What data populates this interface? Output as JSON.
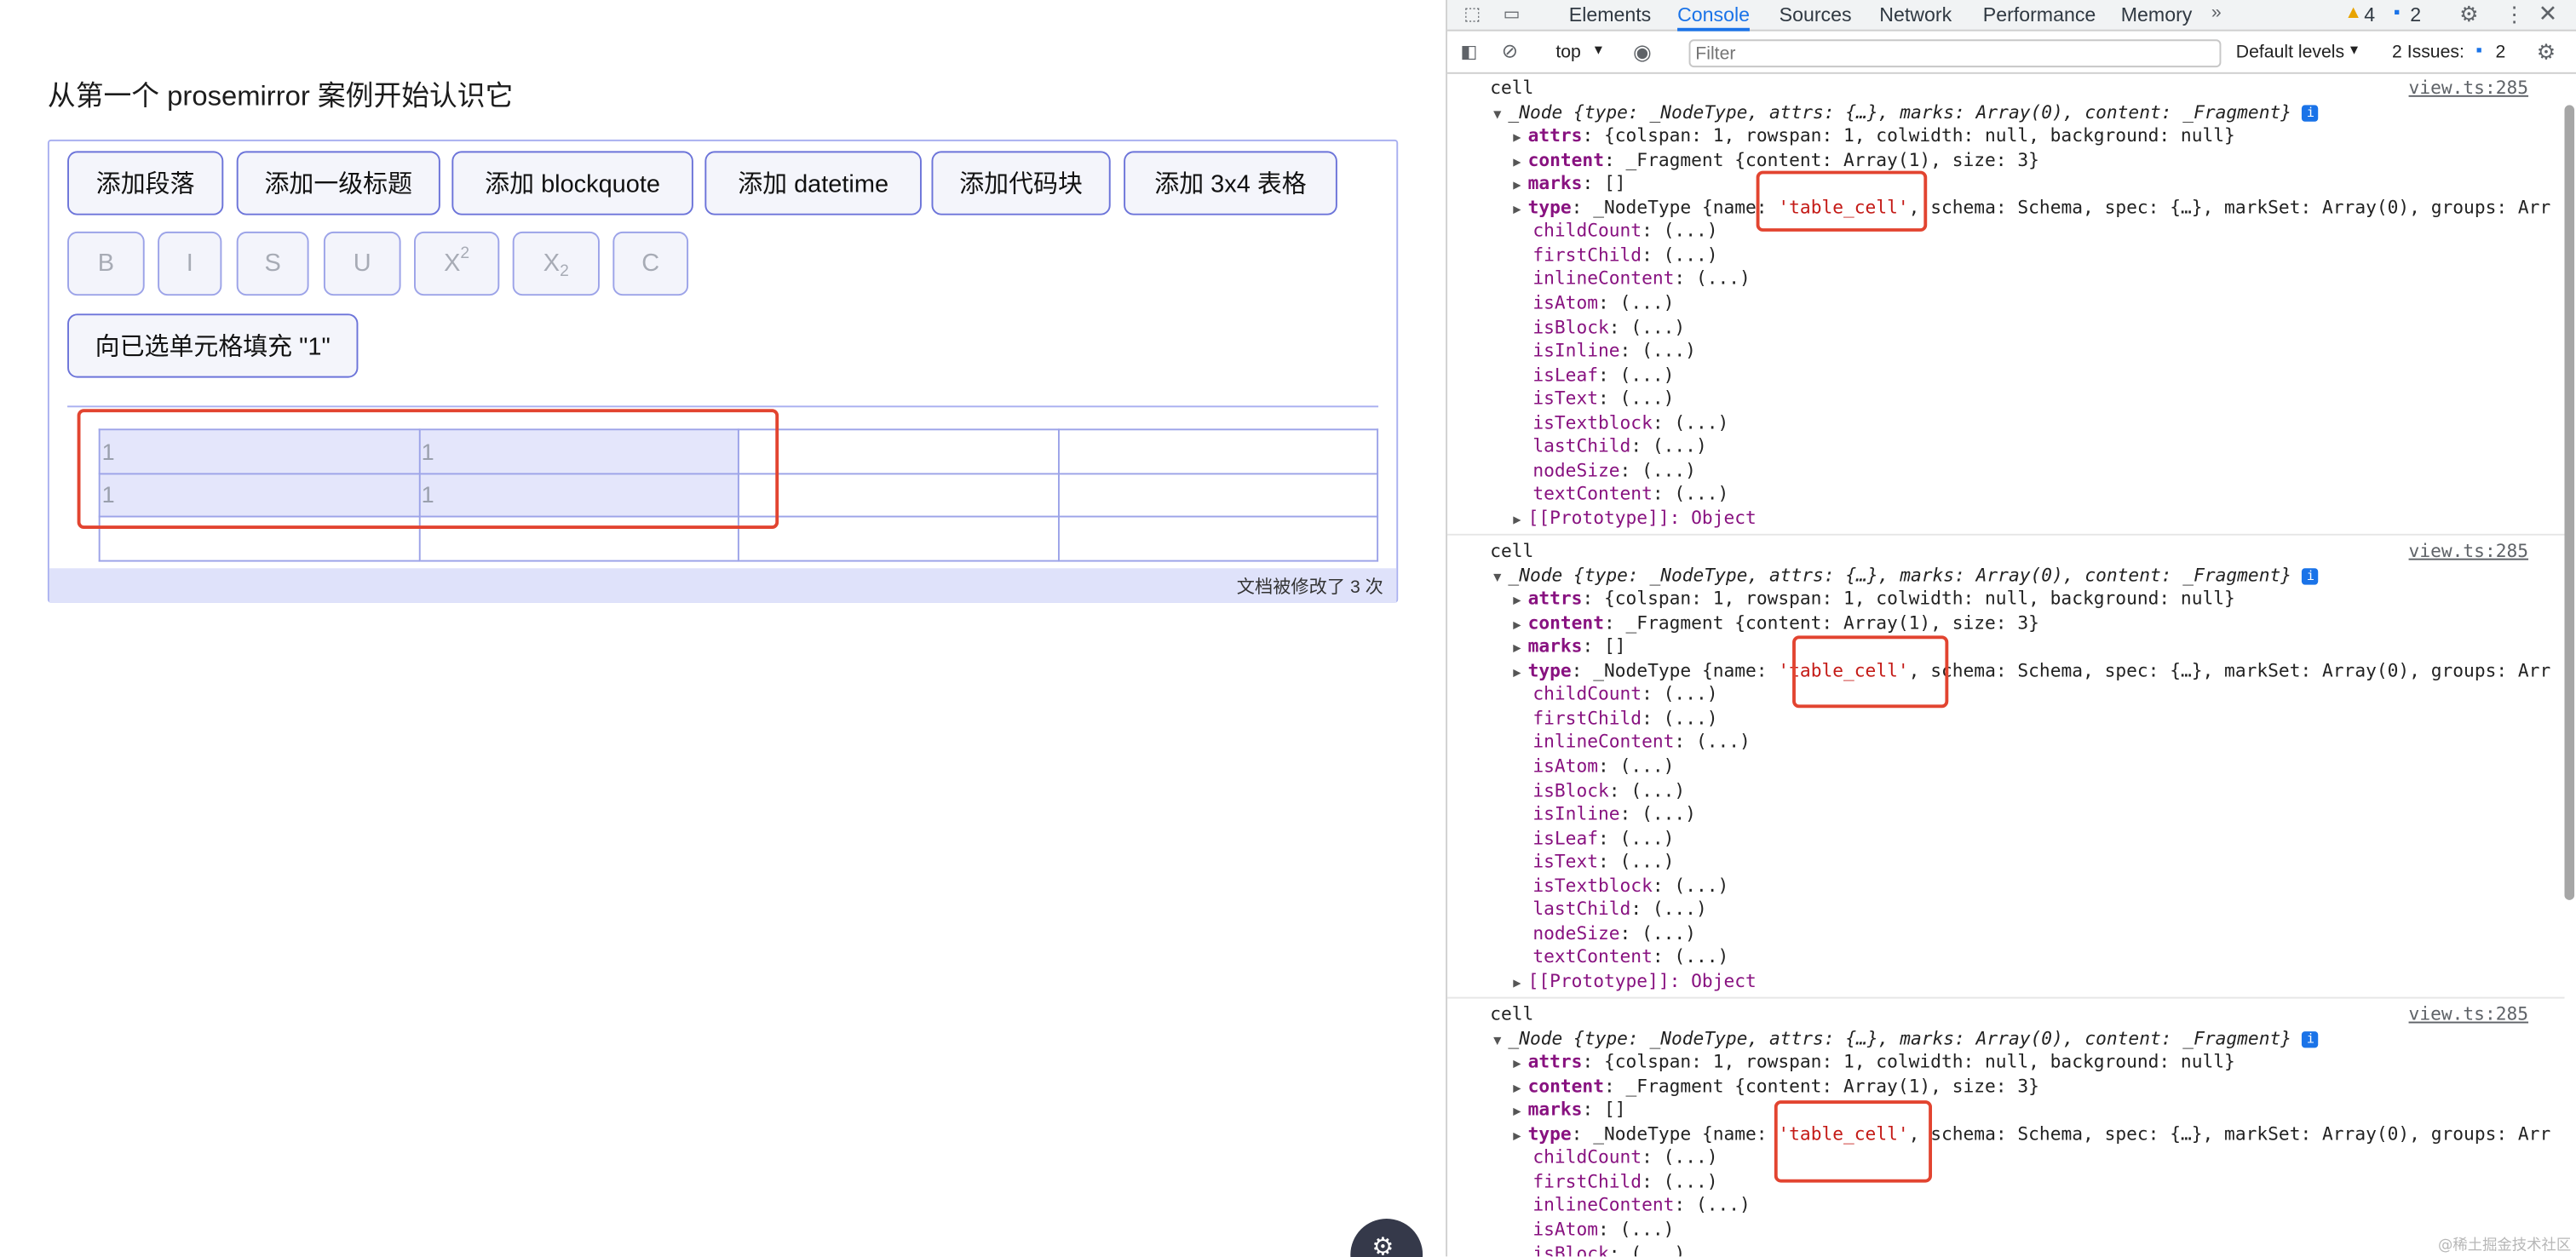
{
  "app": {
    "title": "从第一个 prosemirror 案例开始认识它"
  },
  "toolbar_buttons": [
    {
      "label": "添加段落"
    },
    {
      "label": "添加一级标题"
    },
    {
      "label": "添加 blockquote"
    },
    {
      "label": "添加 datetime"
    },
    {
      "label": "添加代码块"
    },
    {
      "label": "添加 3x4 表格"
    }
  ],
  "format_buttons": [
    "B",
    "I",
    "S",
    "U",
    "X2",
    "X2",
    "C"
  ],
  "fill_button": {
    "label": "向已选单元格填充 \"1\""
  },
  "table": {
    "rows": [
      [
        "1",
        "1",
        "",
        ""
      ],
      [
        "1",
        "1",
        "",
        ""
      ],
      [
        "",
        "",
        "",
        ""
      ]
    ]
  },
  "status": {
    "text": "文档被修改了 3 次"
  },
  "devtools": {
    "tabs": [
      "Elements",
      "Console",
      "Sources",
      "Network",
      "Performance",
      "Memory"
    ],
    "active_tab": "Console",
    "warnings": "4",
    "messages": "2",
    "context": "top",
    "filter_placeholder": "Filter",
    "levels": "Default levels",
    "issues_label": "2 Issues:",
    "issues_count": "2"
  },
  "log_entries": [
    {
      "label": "cell",
      "source": "view.ts:285",
      "node": "_Node {type: _NodeType, attrs: {…}, marks: Array(0), content: _Fragment}",
      "attrs": "{colspan: 1, rowspan: 1, colwidth: null, background: null}",
      "content": "_Fragment {content: Array(1), size: 3}",
      "marks": "[]",
      "type_prefix": "_NodeType {name: ",
      "type_name": "'table_cell'",
      "type_suffix": ", schema: Schema, spec: {…}, markSet: Array(0), groups: Arr",
      "getters": [
        "childCount",
        "firstChild",
        "inlineContent",
        "isAtom",
        "isBlock",
        "isInline",
        "isLeaf",
        "isText",
        "isTextblock",
        "lastChild",
        "nodeSize",
        "textContent"
      ],
      "getter_value": "(...)",
      "prototype": "[[Prototype]]: Object"
    },
    {
      "label": "cell",
      "source": "view.ts:285",
      "node": "_Node {type: _NodeType, attrs: {…}, marks: Array(0), content: _Fragment}",
      "attrs": "{colspan: 1, rowspan: 1, colwidth: null, background: null}",
      "content": "_Fragment {content: Array(1), size: 3}",
      "marks": "[]",
      "type_prefix": "_NodeType {name: ",
      "type_name": "'table_cell'",
      "type_suffix": ", schema: Schema, spec: {…}, markSet: Array(0), groups: Arr",
      "getters": [
        "childCount",
        "firstChild",
        "inlineContent",
        "isAtom",
        "isBlock",
        "isInline",
        "isLeaf",
        "isText",
        "isTextblock",
        "lastChild",
        "nodeSize",
        "textContent"
      ],
      "getter_value": "(...)",
      "prototype": "[[Prototype]]: Object"
    },
    {
      "label": "cell",
      "source": "view.ts:285",
      "node": "_Node {type: _NodeType, attrs: {…}, marks: Array(0), content: _Fragment}",
      "attrs": "{colspan: 1, rowspan: 1, colwidth: null, background: null}",
      "content": "_Fragment {content: Array(1), size: 3}",
      "marks": "[]",
      "type_prefix": "_NodeType {name: ",
      "type_name": "'table_cell'",
      "type_suffix": ", schema: Schema, spec: {…}, markSet: Array(0), groups: Arr",
      "getters": [
        "childCount",
        "firstChild",
        "inlineContent",
        "isAtom",
        "isBlock"
      ],
      "getter_value": "(...)",
      "prototype": ""
    }
  ],
  "watermark": "@稀土掘金技术社区",
  "colors": {
    "accent": "#1a73e8",
    "highlight_red": "#e24430",
    "selection": "#e4e6fb"
  }
}
